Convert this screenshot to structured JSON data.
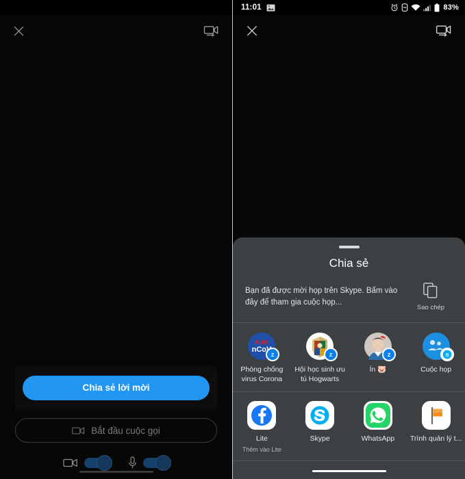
{
  "left_screen": {
    "status_bar": {
      "time": "",
      "battery": "",
      "dimmed": true
    },
    "top_bar": {
      "close_label": "",
      "close_icon": "close-icon",
      "switch_camera_icon": "switch-camera-icon"
    },
    "controls": {
      "share_invite_label": "Chia sẻ lời mời",
      "start_call_label": "Bắt đầu cuộc gọi",
      "start_call_icon": "video-camera-icon",
      "camera_toggle": {
        "icon": "video-camera-icon",
        "state": "on"
      },
      "mic_toggle": {
        "icon": "microphone-icon",
        "state": "on"
      }
    },
    "accent_color": "#2196f3"
  },
  "right_screen": {
    "status_bar": {
      "time": "11:01",
      "battery_pct": "83%",
      "icons": [
        "image-icon",
        "alarm-icon",
        "dnd-icon",
        "wifi-icon",
        "signal-icon",
        "battery-icon"
      ]
    },
    "top_bar": {
      "close_icon": "close-icon",
      "switch_camera_icon": "switch-camera-icon"
    },
    "share_sheet": {
      "title": "Chia sẻ",
      "message": "Bạn đã được mời họp trên Skype. Bấm vào đây để tham gia cuộc họp...",
      "copy_action": {
        "label": "Sao chép",
        "icon": "copy-icon"
      },
      "direct_share_row": [
        {
          "label": "Phòng chống virus Corona",
          "icon": "ncov-avatar",
          "badge": "zalo-badge"
        },
        {
          "label": "Hội học sinh ưu tú Hogwarts",
          "icon": "hogwarts-avatar",
          "badge": "zalo-badge"
        },
        {
          "label": "Ín 🐷",
          "icon": "person-avatar",
          "badge": "zalo-badge"
        },
        {
          "label": "Cuộc họp",
          "icon": "group-avatar",
          "badge": "skype-badge"
        }
      ],
      "app_row": [
        {
          "label": "Lite",
          "sublabel": "Thêm vào Lite",
          "icon": "facebook-lite-icon"
        },
        {
          "label": "Skype",
          "sublabel": "",
          "icon": "skype-icon"
        },
        {
          "label": "WhatsApp",
          "sublabel": "",
          "icon": "whatsapp-icon"
        },
        {
          "label": "Trình quản lý t...",
          "sublabel": "",
          "icon": "file-manager-icon"
        }
      ]
    },
    "sheet_color": "#3c4043"
  }
}
